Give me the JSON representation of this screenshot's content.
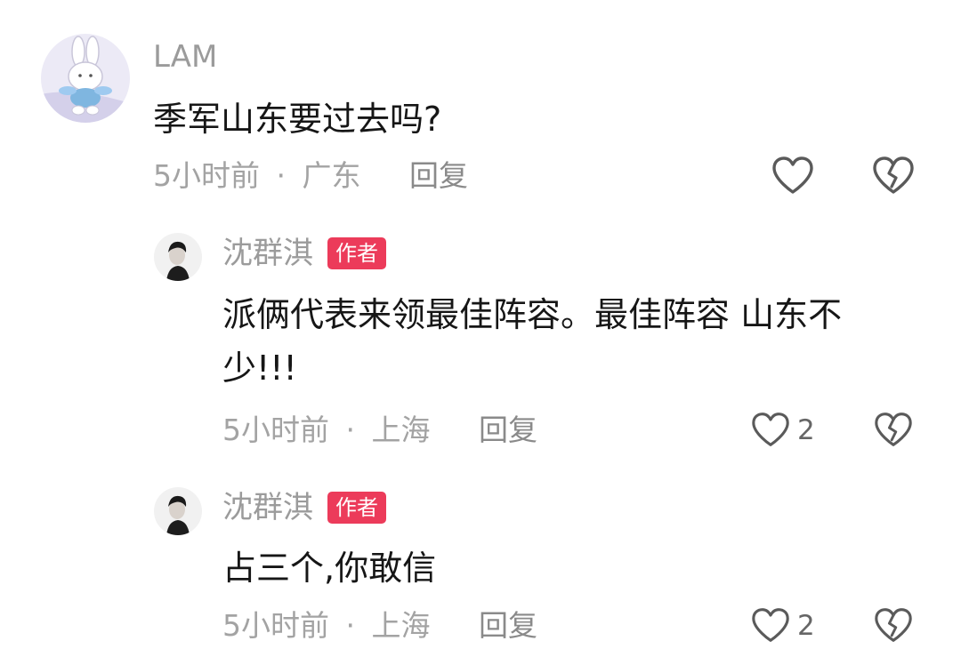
{
  "comments": [
    {
      "username": "LAM",
      "text": "季军山东要过去吗?",
      "time": "5小时前",
      "location": "广东",
      "reply_label": "回复",
      "like_count": "",
      "icons": {
        "avatar": "bunny-avatar",
        "like": "heart-outline-icon",
        "dislike": "broken-heart-icon"
      }
    },
    {
      "username": "沈群淇",
      "badge": "作者",
      "text_line1": "派俩代表来领最佳阵容。最佳阵容 山东不",
      "text_line2": "少!!!",
      "time": "5小时前",
      "location": "上海",
      "reply_label": "回复",
      "like_count": "2",
      "icons": {
        "avatar": "author-portrait-avatar",
        "like": "heart-outline-icon",
        "dislike": "broken-heart-icon"
      }
    },
    {
      "username": "沈群淇",
      "badge": "作者",
      "text": "占三个,你敢信",
      "time": "5小时前",
      "location": "上海",
      "reply_label": "回复",
      "like_count": "2",
      "icons": {
        "avatar": "author-portrait-avatar",
        "like": "heart-outline-icon",
        "dislike": "broken-heart-icon"
      }
    }
  ],
  "meta_separator": "·",
  "colors": {
    "author_badge": "#ec3b5a",
    "meta_text": "#a3a3a3",
    "comment_text": "#161616"
  }
}
